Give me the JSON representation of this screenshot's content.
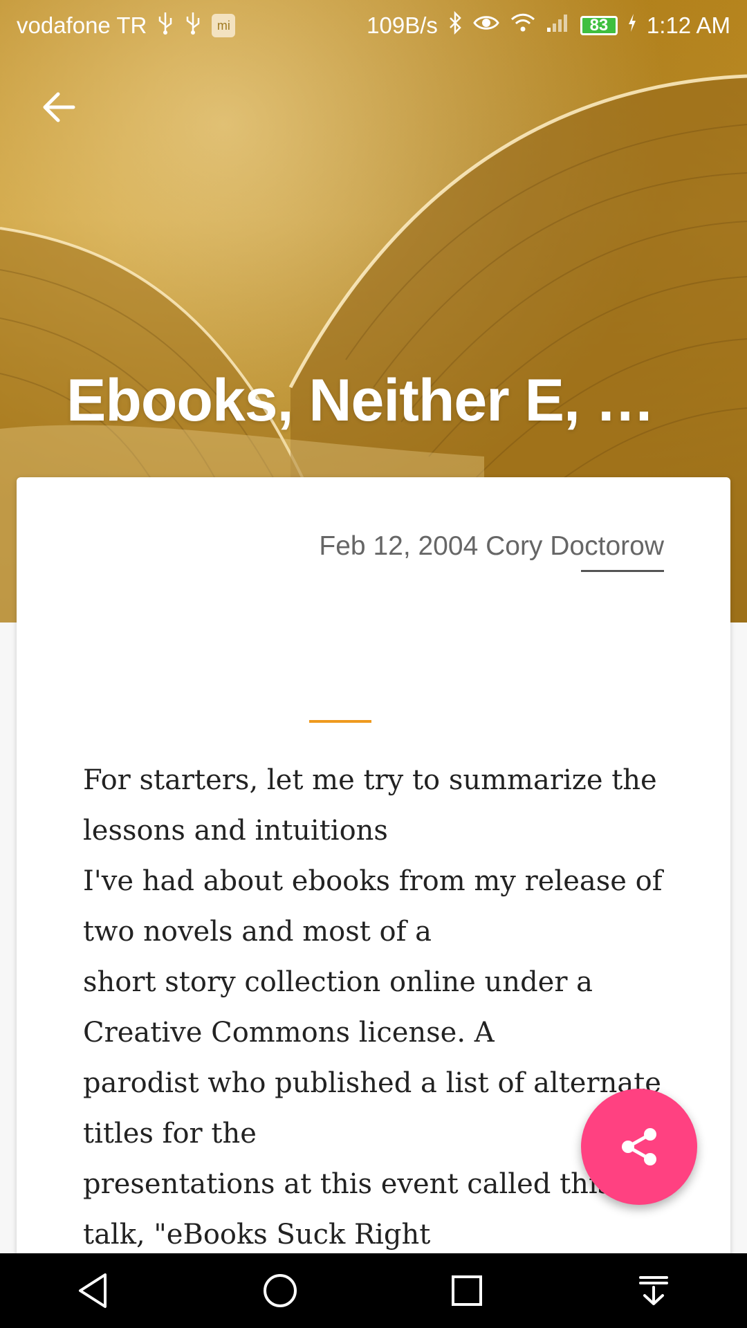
{
  "status_bar": {
    "carrier": "vodafone TR",
    "net_speed": "109B/s",
    "battery": "83",
    "time": "1:12 AM",
    "icons": [
      "usb-icon",
      "usb-icon",
      "mi-icon",
      "bluetooth-icon",
      "eye-icon",
      "wifi-icon",
      "signal-icon",
      "battery-icon",
      "charging-icon"
    ]
  },
  "header": {
    "title": "Ebooks, Neither E, N…",
    "back_icon": "arrow-left-icon"
  },
  "article": {
    "meta": "Feb 12, 2004 Cory Doctorow",
    "body_lines": [
      "For starters, let me try to summarize the",
      "lessons and intuitions",
      "I've had about ebooks from my release of",
      "two novels and most of a",
      "short story collection online under a",
      "Creative Commons license. A",
      "parodist who published a list of alternate",
      "titles for the",
      "presentations at this event called this",
      "talk, \"eBooks Suck Right"
    ]
  },
  "fab": {
    "icon": "share-icon"
  },
  "navbar": {
    "icons": [
      "back-triangle-icon",
      "home-circle-icon",
      "recents-square-icon",
      "notifications-pulldown-icon"
    ]
  },
  "colors": {
    "accent": "#ef9a1f",
    "fab": "#ff4181",
    "hero": "#b8861e"
  }
}
